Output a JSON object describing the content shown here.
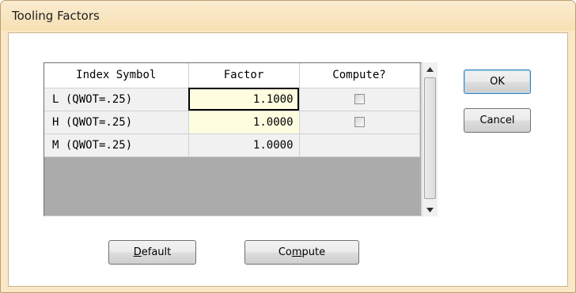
{
  "window": {
    "title": "Tooling Factors"
  },
  "grid": {
    "columns": [
      "Index Symbol",
      "Factor",
      "Compute?"
    ],
    "rows": [
      {
        "symbol": "L (QWOT=.25)",
        "factor": "1.1000",
        "has_checkbox": true,
        "checked": false
      },
      {
        "symbol": "H (QWOT=.25)",
        "factor": "1.0000",
        "has_checkbox": true,
        "checked": false
      },
      {
        "symbol": "M (QWOT=.25)",
        "factor": "1.0000",
        "has_checkbox": false,
        "checked": false
      }
    ]
  },
  "buttons": {
    "ok": "OK",
    "cancel": "Cancel",
    "default": {
      "pre": "",
      "key": "D",
      "post": "efault"
    },
    "compute": {
      "pre": "Co",
      "key": "m",
      "post": "pute"
    }
  },
  "icons": {
    "scroll_up": "scroll-up-arrow-icon",
    "scroll_down": "scroll-down-arrow-icon",
    "checkbox": "checkbox-icon"
  },
  "colors": {
    "frame": "#f9e7c5",
    "editable_cell": "#fffde0",
    "grid_empty": "#ababab"
  }
}
